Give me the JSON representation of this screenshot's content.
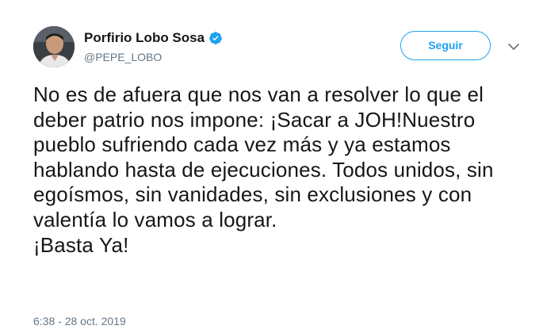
{
  "tweet": {
    "author": {
      "display_name": "Porfirio Lobo Sosa",
      "handle": "@PEPE_LOBO",
      "verified": true,
      "avatar_icon": "profile-photo"
    },
    "follow_label": "Seguir",
    "menu_icon": "chevron-down-icon",
    "text": "No es de afuera que nos van a resolver lo que el deber patrio nos impone: ¡Sacar a JOH!Nuestro pueblo sufriendo cada vez más y ya estamos hablando hasta de ejecuciones. Todos unidos, sin egoísmos, sin vanidades, sin exclusiones y con valentía lo vamos a lograr.\n¡Basta Ya!",
    "timestamp": "6:38 - 28 oct. 2019"
  },
  "colors": {
    "accent": "#1da1f2",
    "text": "#14171a",
    "muted": "#657786"
  }
}
